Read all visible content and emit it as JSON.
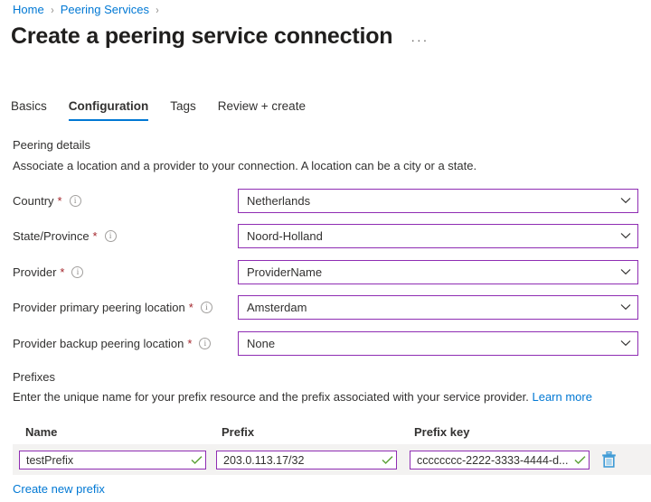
{
  "breadcrumb": {
    "items": [
      {
        "label": "Home"
      },
      {
        "label": "Peering Services"
      }
    ],
    "separator": "›"
  },
  "header": {
    "title": "Create a peering service connection",
    "more_menu": "···"
  },
  "tabs": [
    {
      "label": "Basics",
      "active": false
    },
    {
      "label": "Configuration",
      "active": true
    },
    {
      "label": "Tags",
      "active": false
    },
    {
      "label": "Review + create",
      "active": false
    }
  ],
  "peering_details": {
    "heading": "Peering details",
    "description": "Associate a location and a provider to your connection. A location can be a city or a state.",
    "fields": [
      {
        "label": "Country",
        "required": "*",
        "info": "info-icon",
        "value": "Netherlands"
      },
      {
        "label": "State/Province",
        "required": "*",
        "info": "info-icon",
        "value": "Noord-Holland"
      },
      {
        "label": "Provider",
        "required": "*",
        "info": "info-icon",
        "value": "ProviderName"
      },
      {
        "label": "Provider primary peering location",
        "required": "*",
        "info": "info-icon",
        "value": "Amsterdam"
      },
      {
        "label": "Provider backup peering location",
        "required": "*",
        "info": "info-icon",
        "value": "None"
      }
    ]
  },
  "prefixes": {
    "heading": "Prefixes",
    "description": "Enter the unique name for your prefix resource and the prefix associated with your service provider.",
    "learn_more": "Learn more",
    "columns": [
      "Name",
      "Prefix",
      "Prefix key"
    ],
    "rows": [
      {
        "name": "testPrefix",
        "prefix": "203.0.113.17/32",
        "prefix_key": "cccccccc-2222-3333-4444-d...",
        "delete_icon": "trash-icon"
      }
    ],
    "create_link": "Create new prefix"
  },
  "colors": {
    "link": "#0078d4",
    "accent_tab": "#0078d4",
    "field_border": "#8f2db3",
    "required_star": "#a4262c",
    "valid_check": "#5ea33a",
    "row_band": "#f3f2f1",
    "trash": "#3f9bd6"
  }
}
